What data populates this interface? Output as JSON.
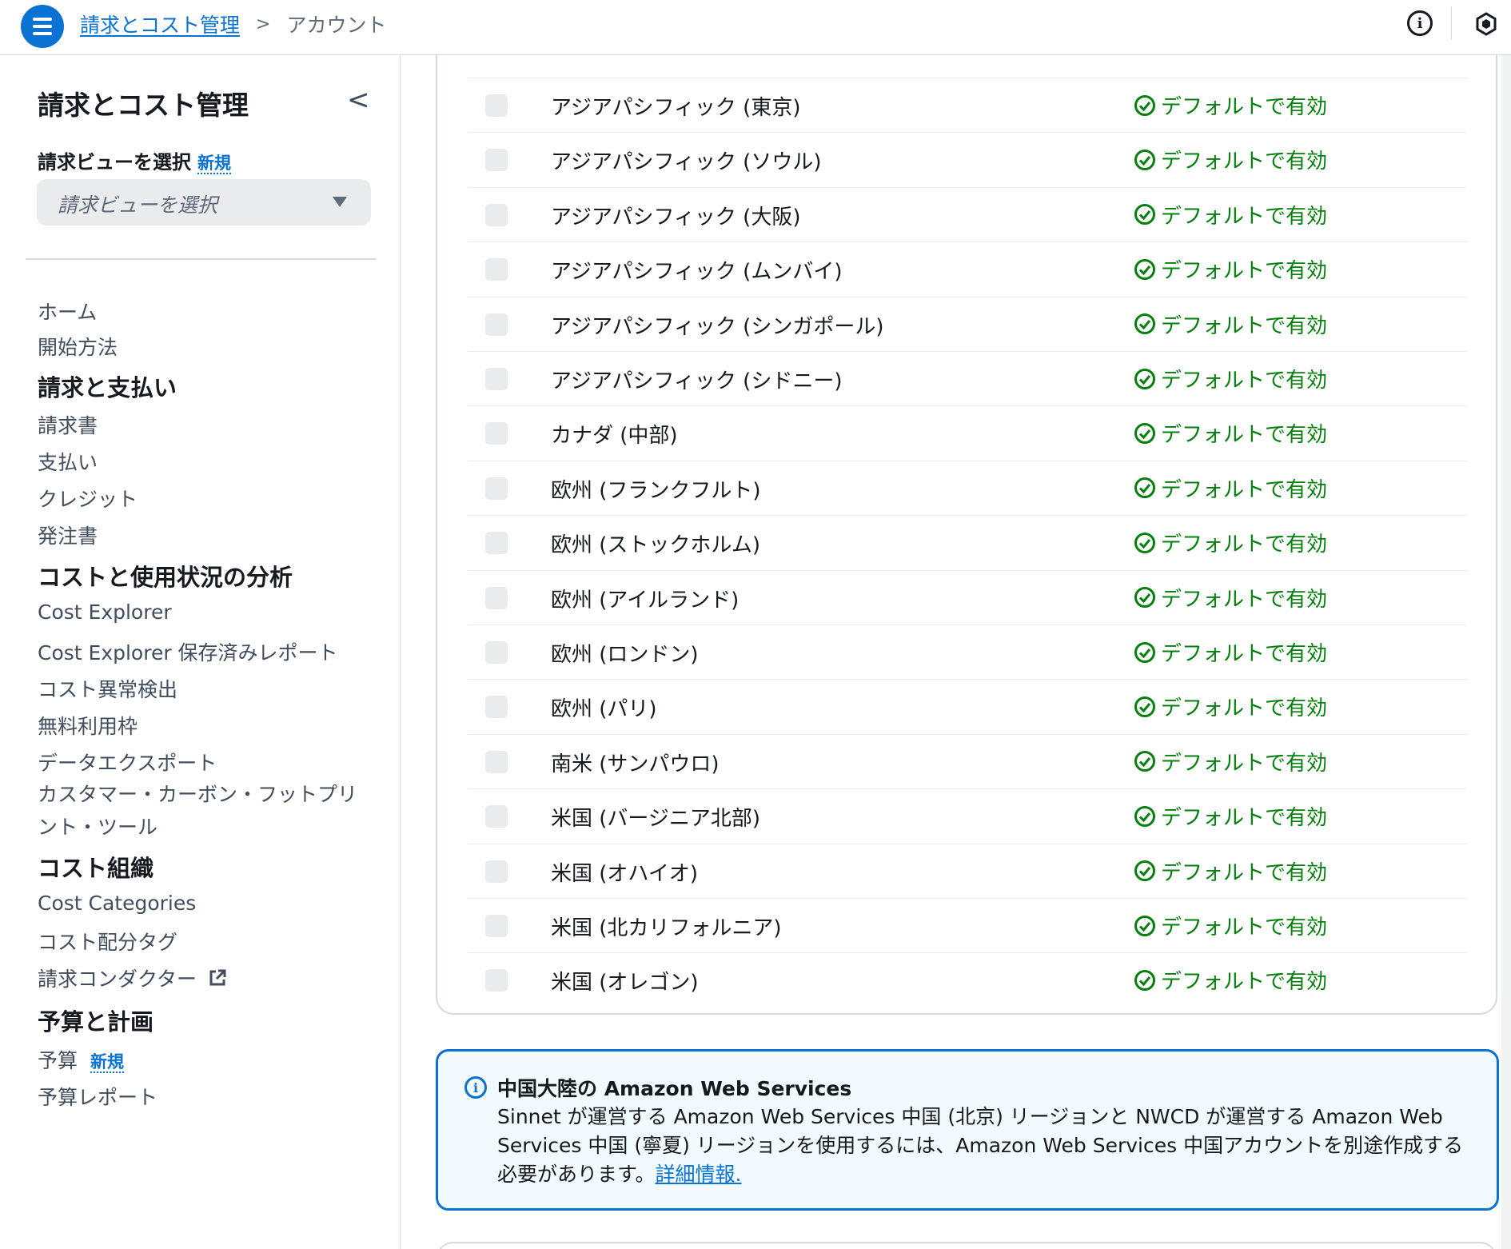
{
  "header": {
    "breadcrumb_service": "請求とコスト管理",
    "breadcrumb_separator": ">",
    "breadcrumb_current": "アカウント",
    "info_icon_glyph": "i"
  },
  "sidebar": {
    "title": "請求とコスト管理",
    "collapse_glyph": "<",
    "view_label": "請求ビューを選択",
    "new_badge": "新規",
    "view_select_placeholder": "請求ビューを選択",
    "links_top": [
      "ホーム",
      "開始方法"
    ],
    "section_billing": "請求と支払い",
    "links_billing": [
      "請求書",
      "支払い",
      "クレジット",
      "発注書"
    ],
    "section_analysis": "コストと使用状況の分析",
    "links_analysis": [
      "Cost Explorer",
      "Cost Explorer 保存済みレポート",
      "コスト異常検出",
      "無料利用枠",
      "データエクスポート",
      "カスタマー・カーボン・フットプリント・ツール"
    ],
    "section_org": "コスト組織",
    "links_org": [
      "Cost Categories",
      "コスト配分タグ",
      "請求コンダクター"
    ],
    "section_budget": "予算と計画",
    "links_budget": [
      "予算",
      "予算レポート"
    ]
  },
  "regions": {
    "status_color": "#037f0c",
    "rows": [
      {
        "name": "アジアパシフィック (東京)",
        "status": "デフォルトで有効"
      },
      {
        "name": "アジアパシフィック (ソウル)",
        "status": "デフォルトで有効"
      },
      {
        "name": "アジアパシフィック (大阪)",
        "status": "デフォルトで有効"
      },
      {
        "name": "アジアパシフィック (ムンバイ)",
        "status": "デフォルトで有効"
      },
      {
        "name": "アジアパシフィック (シンガポール)",
        "status": "デフォルトで有効"
      },
      {
        "name": "アジアパシフィック (シドニー)",
        "status": "デフォルトで有効"
      },
      {
        "name": "カナダ (中部)",
        "status": "デフォルトで有効"
      },
      {
        "name": "欧州 (フランクフルト)",
        "status": "デフォルトで有効"
      },
      {
        "name": "欧州 (ストックホルム)",
        "status": "デフォルトで有効"
      },
      {
        "name": "欧州 (アイルランド)",
        "status": "デフォルトで有効"
      },
      {
        "name": "欧州 (ロンドン)",
        "status": "デフォルトで有効"
      },
      {
        "name": "欧州 (パリ)",
        "status": "デフォルトで有効"
      },
      {
        "name": "南米 (サンパウロ)",
        "status": "デフォルトで有効"
      },
      {
        "name": "米国 (バージニア北部)",
        "status": "デフォルトで有効"
      },
      {
        "name": "米国 (オハイオ)",
        "status": "デフォルトで有効"
      },
      {
        "name": "米国 (北カリフォルニア)",
        "status": "デフォルトで有効"
      },
      {
        "name": "米国 (オレゴン)",
        "status": "デフォルトで有効"
      }
    ]
  },
  "china_notice": {
    "title": "中国大陸の Amazon Web Services",
    "body": "Sinnet が運営する Amazon Web Services 中国 (北京) リージョンと NWCD が運営する Amazon Web Services 中国 (寧夏) リージョンを使用するには、Amazon Web Services 中国アカウントを別途作成する必要があります。",
    "link": "詳細情報."
  },
  "colors": {
    "accent": "#0972d3",
    "success": "#037f0c",
    "border": "#d5dbdb"
  }
}
